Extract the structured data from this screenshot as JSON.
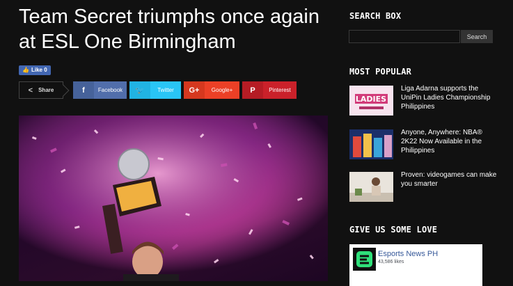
{
  "article": {
    "title": "Team Secret triumphs once again at ESL One Birmingham",
    "like_label": "Like 0"
  },
  "share": {
    "label": "Share",
    "buttons": [
      {
        "label": "Facebook",
        "icon": "facebook-icon",
        "color": "#516eab"
      },
      {
        "label": "Twitter",
        "icon": "twitter-icon",
        "color": "#29c5f6"
      },
      {
        "label": "Google+",
        "icon": "google-plus-icon",
        "color": "#eb4026"
      },
      {
        "label": "Pinterest",
        "icon": "pinterest-icon",
        "color": "#ca212a"
      }
    ]
  },
  "sidebar": {
    "search_title": "SEARCH BOX",
    "search_button": "Search",
    "popular_title": "MOST POPULAR",
    "popular": [
      {
        "title": "Liga Adarna supports the UniPin Ladies Championship Philippines"
      },
      {
        "title": "Anyone, Anywhere: NBA® 2K22 Now Available in the Philippines"
      },
      {
        "title": "Proven: videogames can make you smarter"
      }
    ],
    "love_title": "GIVE US SOME LOVE",
    "fb_page": {
      "name": "Esports News PH",
      "likes": "43,586 likes"
    }
  }
}
